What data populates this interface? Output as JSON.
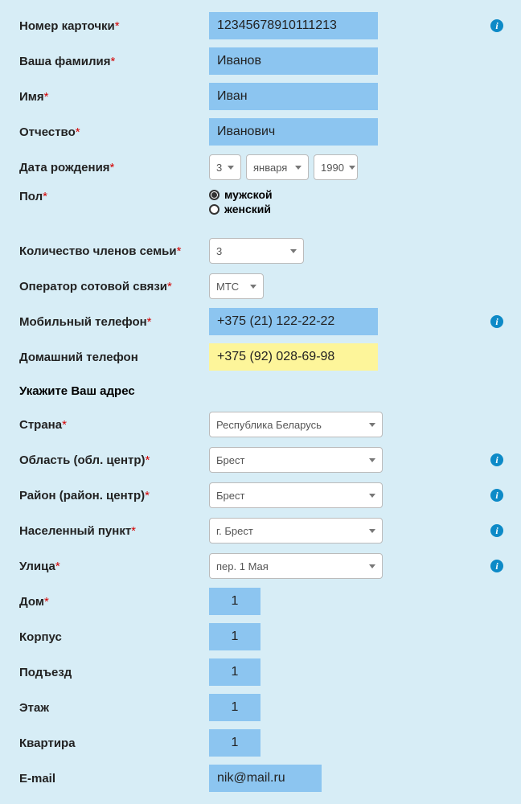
{
  "fields": {
    "card_number": {
      "label": "Номер карточки",
      "value": "12345678910111213",
      "required": true,
      "info": true
    },
    "surname": {
      "label": "Ваша фамилия",
      "value": "Иванов",
      "required": true
    },
    "name": {
      "label": "Имя",
      "value": "Иван",
      "required": true
    },
    "patronymic": {
      "label": "Отчество",
      "value": "Иванович",
      "required": true
    },
    "dob": {
      "label": "Дата рождения",
      "day": "3",
      "month": "января",
      "year": "1990",
      "required": true
    },
    "gender": {
      "label": "Пол",
      "required": true,
      "male": "мужской",
      "female": "женский",
      "selected": "male"
    },
    "family_members": {
      "label": "Количество членов семьи",
      "value": "3",
      "required": true
    },
    "operator": {
      "label": "Оператор сотовой связи",
      "value": "МТС",
      "required": true
    },
    "mobile": {
      "label": "Мобильный телефон",
      "value": "+375 (21) 122-22-22",
      "required": true,
      "info": true
    },
    "home_phone": {
      "label": "Домашний телефон",
      "value": "+375 (92) 028-69-98",
      "required": false
    },
    "address_header": "Укажите Ваш адрес",
    "country": {
      "label": "Страна",
      "value": "Республика Беларусь",
      "required": true
    },
    "region": {
      "label": "Область (обл. центр)",
      "value": "Брест",
      "required": true,
      "info": true
    },
    "district": {
      "label": "Район (район. центр)",
      "value": "Брест",
      "required": true,
      "info": true
    },
    "locality": {
      "label": "Населенный пункт",
      "value": "г. Брест",
      "required": true,
      "info": true
    },
    "street": {
      "label": "Улица",
      "value": "пер. 1 Мая",
      "required": true,
      "info": true
    },
    "house": {
      "label": "Дом",
      "value": "1",
      "required": true
    },
    "building": {
      "label": "Корпус",
      "value": "1",
      "required": false
    },
    "entrance": {
      "label": "Подъезд",
      "value": "1",
      "required": false
    },
    "floor": {
      "label": "Этаж",
      "value": "1",
      "required": false
    },
    "apartment": {
      "label": "Квартира",
      "value": "1",
      "required": false
    },
    "email": {
      "label": "E-mail",
      "value": "nik@mail.ru",
      "required": false
    }
  },
  "asterisk": "*"
}
